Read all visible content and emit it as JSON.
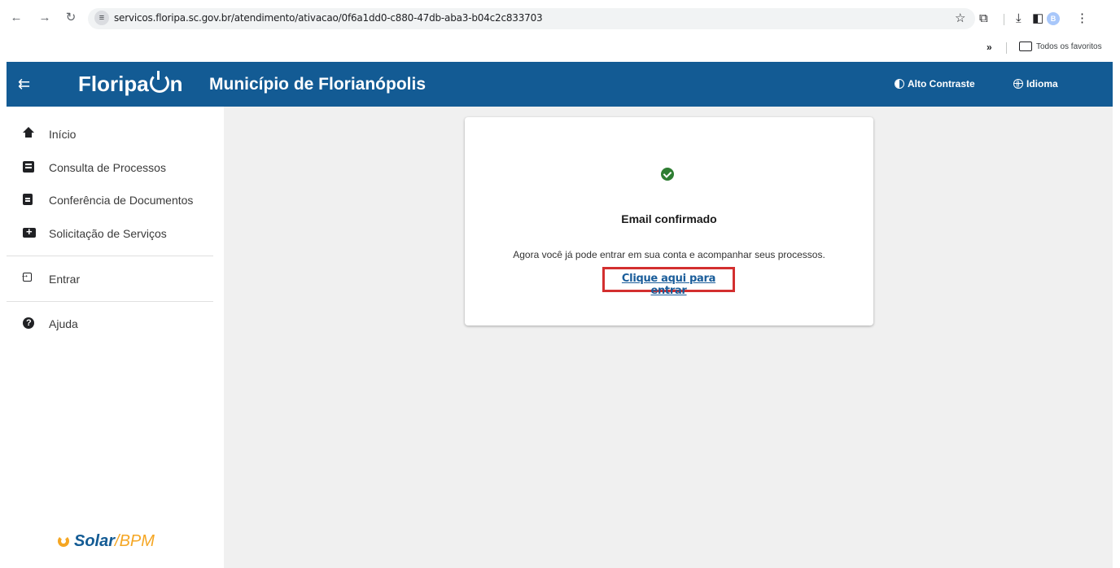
{
  "browser": {
    "url": "servicos.floripa.sc.gov.br/atendimento/ativacao/0f6a1dd0-c880-47db-aba3-b04c2c833703",
    "profile_initial": "B",
    "bookmarks_label": "Todos os favoritos",
    "icons": [
      "back-icon",
      "forward-icon",
      "reload-icon",
      "site-settings-icon",
      "star-icon",
      "extensions-icon",
      "download-icon",
      "side-panel-icon",
      "menu-icon",
      "folder-icon"
    ]
  },
  "header": {
    "logo_pre": "Floripa",
    "logo_post": "n",
    "title": "Município de Florianópolis",
    "high_contrast_label": "Alto Contraste",
    "language_label": "Idioma",
    "color": "#135b94"
  },
  "sidebar": {
    "items": [
      {
        "label": "Início",
        "icon": "home-icon"
      },
      {
        "label": "Consulta de Processos",
        "icon": "list-icon"
      },
      {
        "label": "Conferência de Documentos",
        "icon": "clipboard-icon"
      },
      {
        "label": "Solicitação de Serviços",
        "icon": "folder-plus-icon"
      },
      {
        "label": "Entrar",
        "icon": "login-icon"
      },
      {
        "label": "Ajuda",
        "icon": "help-icon"
      }
    ],
    "footer_brand": "Solar",
    "footer_brand_suffix": "/BPM"
  },
  "card": {
    "title": "Email confirmado",
    "message": "Agora você já pode entrar em sua conta e acompanhar seus processos.",
    "link_label": "Clique aqui para entrar",
    "highlight_color": "#d32f2f",
    "success_color": "#2e7d32"
  }
}
